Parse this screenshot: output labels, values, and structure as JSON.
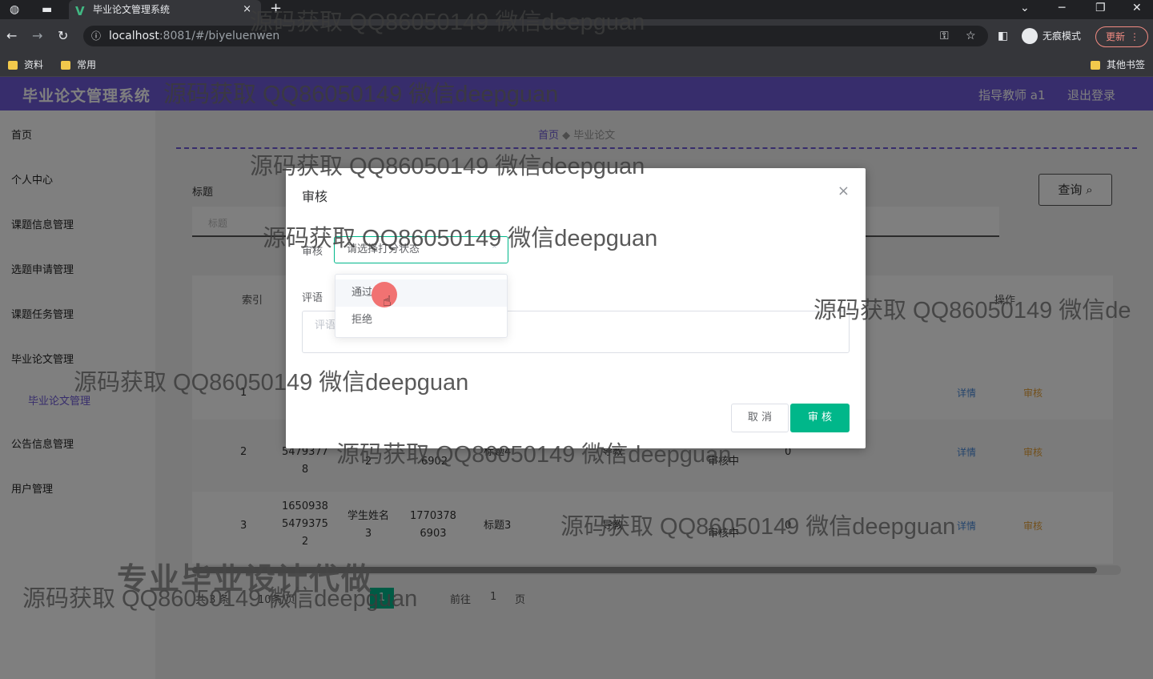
{
  "browser": {
    "tab_title": "毕业论文管理系统",
    "tab_close": "×",
    "new_tab": "+",
    "url_host": "localhost",
    "url_path": ":8081/#/biyeluenwen",
    "profile_label": "无痕模式",
    "update_label": "更新",
    "bookmarks": [
      "资料",
      "常用"
    ],
    "other_bookmarks": "其他书签"
  },
  "app": {
    "title": "毕业论文管理系统",
    "teacher": "指导教师 a1",
    "logout": "退出登录"
  },
  "sidebar": {
    "items": [
      "首页",
      "个人中心",
      "课题信息管理",
      "选题申请管理",
      "课题任务管理",
      "毕业论文管理",
      "公告信息管理",
      "用户管理"
    ],
    "sub_item": "毕业论文管理"
  },
  "breadcrumb": {
    "home": "首页",
    "current": "毕业论文"
  },
  "search": {
    "label": "标题",
    "placeholder": "标题",
    "button": "查询"
  },
  "table": {
    "headers": {
      "index": "索引",
      "action": "操作"
    },
    "rows": [
      {
        "index": "1",
        "id": "",
        "name": "",
        "phone": "",
        "title": "",
        "teacher": "",
        "status": "",
        "score": ""
      },
      {
        "index": "2",
        "id": "5479377\n8",
        "name": "2",
        "phone": "6902",
        "title": "标题4",
        "teacher": "导教",
        "status": "审核中",
        "score": "0"
      },
      {
        "index": "3",
        "id": "1650938\n5479375\n2",
        "name": "学生姓名\n3",
        "phone": "1770378\n6903",
        "title": "标题3",
        "teacher": "导教",
        "status": "审核中",
        "score": "0"
      }
    ],
    "detail_label": "详情",
    "audit_label": "审核"
  },
  "pager": {
    "total": "共 3 条",
    "per_page": "10条/页",
    "goto": "前往",
    "page": "1",
    "page_suffix": "页",
    "current": "1"
  },
  "dialog": {
    "title": "审核",
    "audit_label": "审核",
    "select_placeholder": "请选择打分状态",
    "comment_label": "评语",
    "comment_placeholder": "评语",
    "options": [
      "通过",
      "拒绝"
    ],
    "cancel": "取 消",
    "submit": "审 核",
    "close": "×"
  },
  "watermarks": {
    "text": "源码获取 QQ86050149 微信deepguan",
    "partial": "源码获取 QQ86050149 微信de",
    "big": "专业毕业设计代做"
  },
  "colors": {
    "accent": "#6f5bd8",
    "primary": "#00b78a"
  }
}
